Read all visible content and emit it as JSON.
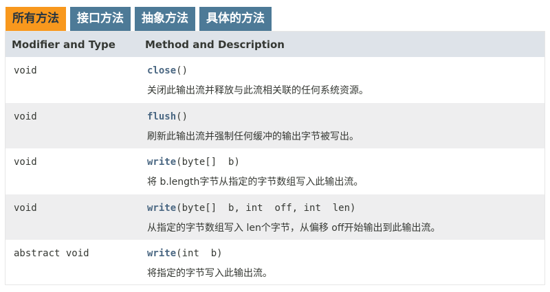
{
  "tabs": [
    {
      "label": "所有方法",
      "active": true
    },
    {
      "label": "接口方法",
      "active": false
    },
    {
      "label": "抽象方法",
      "active": false
    },
    {
      "label": "具体的方法",
      "active": false
    }
  ],
  "table": {
    "headers": {
      "type": "Modifier and Type",
      "method": "Method and Description"
    },
    "rows": [
      {
        "type": "void",
        "name": "close",
        "params": "()",
        "description": "关闭此输出流并释放与此流相关联的任何系统资源。"
      },
      {
        "type": "void",
        "name": "flush",
        "params": "()",
        "description": "刷新此输出流并强制任何缓冲的输出字节被写出。"
      },
      {
        "type": "void",
        "name": "write",
        "params": "(byte[]  b)",
        "description": "将 b.length字节从指定的字节数组写入此输出流。"
      },
      {
        "type": "void",
        "name": "write",
        "params": "(byte[]  b, int  off, int  len)",
        "description": "从指定的字节数组写入 len个字节，从偏移 off开始输出到此输出流。"
      },
      {
        "type": "abstract void",
        "name": "write",
        "params": "(int  b)",
        "description": "将指定的字节写入此输出流。"
      }
    ]
  },
  "colors": {
    "active_tab": "#f8981d",
    "inactive_tab": "#4d7a97",
    "header_bg": "#dee3e9",
    "alt_row_bg": "#eeeeef",
    "method_name": "#4a6782"
  }
}
